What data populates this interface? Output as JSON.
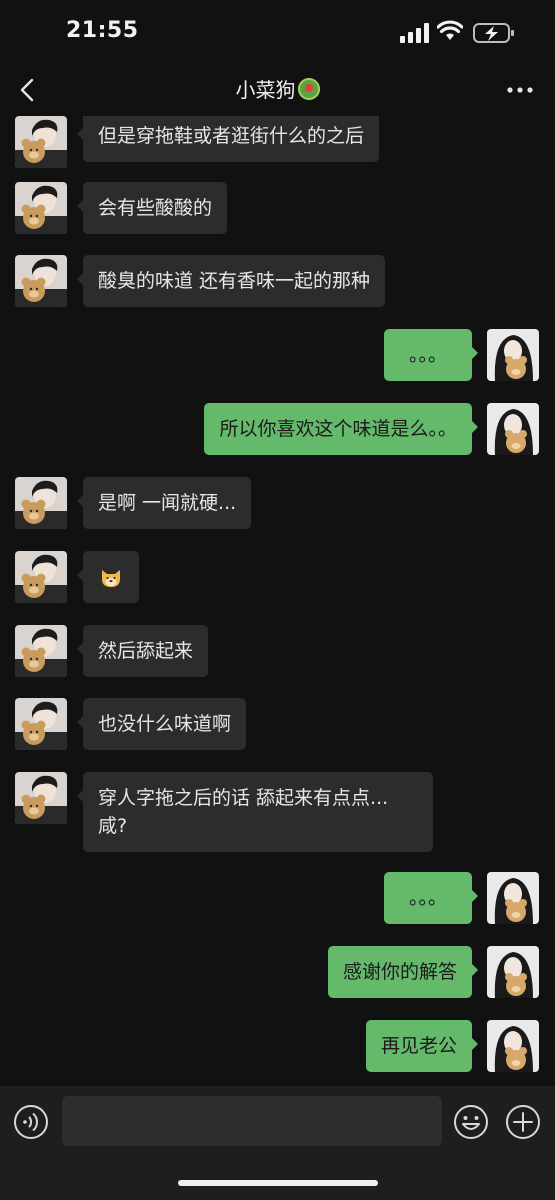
{
  "status": {
    "time": "21:55"
  },
  "header": {
    "title": "小菜狗",
    "title_emoji": "vegetable-plate-emoji"
  },
  "messages": [
    {
      "side": "in",
      "text": "但是穿拖鞋或者逛街什么的之后"
    },
    {
      "side": "in",
      "text": "会有些酸酸的"
    },
    {
      "side": "in",
      "text": "酸臭的味道 还有香味一起的那种"
    },
    {
      "side": "out",
      "text": "。。。"
    },
    {
      "side": "out",
      "text": "所以你喜欢这个味道是么。。"
    },
    {
      "side": "in",
      "text": "是啊 一闻就硬..."
    },
    {
      "side": "in",
      "text": "",
      "sticker": "dog-face-emoji"
    },
    {
      "side": "in",
      "text": "然后舔起来"
    },
    {
      "side": "in",
      "text": "也没什么味道啊"
    },
    {
      "side": "in",
      "lines": [
        "穿人字拖之后的话 舔起来有点点...",
        "咸?"
      ]
    },
    {
      "side": "out",
      "text": "。。。"
    },
    {
      "side": "out",
      "text": "感谢你的解答"
    },
    {
      "side": "out",
      "text": "再见老公"
    }
  ],
  "input": {
    "placeholder": ""
  },
  "colors": {
    "background": "#111111",
    "incoming_bubble": "#2c2c2c",
    "outgoing_bubble": "#64b96a",
    "input_bar": "#1e1e1e"
  }
}
